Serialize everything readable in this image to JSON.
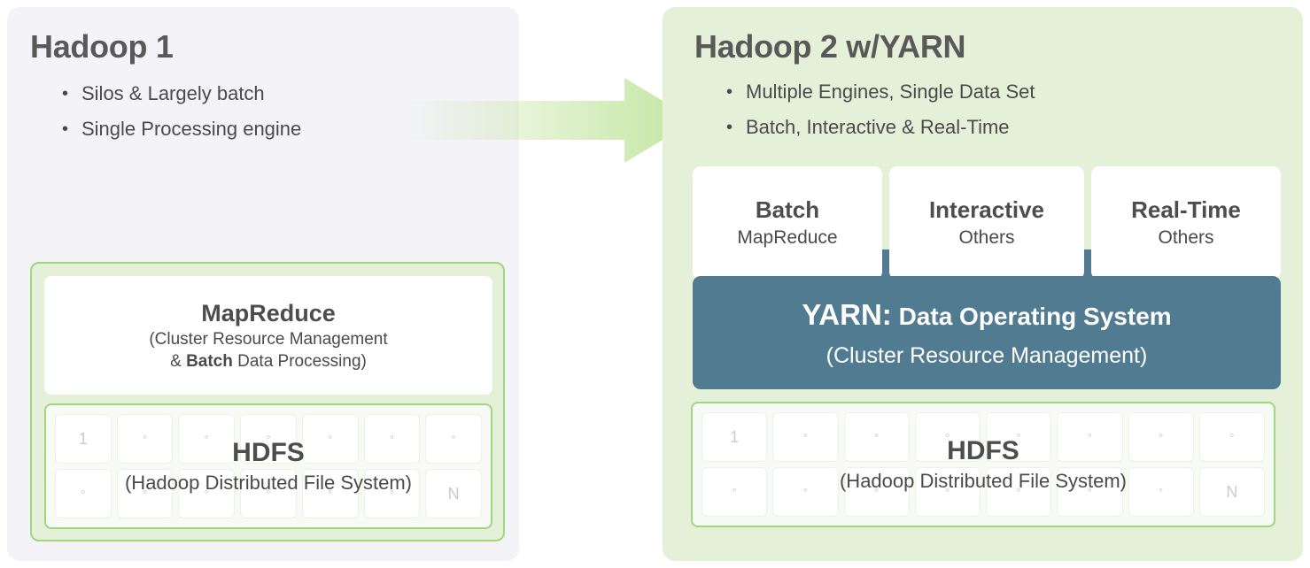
{
  "colors": {
    "left_panel_bg": "#f4f3f8",
    "right_panel_bg": "#e5f0d9",
    "green_border": "#a0d67e",
    "green_fill": "#e4f0d8",
    "yarn_bar": "#507b91",
    "heading_text": "#595959",
    "body_text": "#4a4a4a",
    "node_text": "#c9cdc7",
    "arrow_green": "#c3e5a0"
  },
  "left_panel": {
    "title": "Hadoop 1",
    "bullets": [
      "Silos & Largely batch",
      "Single Processing engine"
    ],
    "mapreduce": {
      "title": "MapReduce",
      "sub_line1": "(Cluster Resource Management",
      "sub_line2_prefix": "& ",
      "sub_line2_bold": "Batch",
      "sub_line2_suffix": " Data Processing)"
    },
    "hdfs": {
      "title": "HDFS",
      "subtitle": "(Hadoop Distributed File System)",
      "columns": 7,
      "rows": 2,
      "cells": [
        "1",
        "°",
        "°",
        "°",
        "°",
        "°",
        "°",
        "°",
        "°",
        "°",
        "°",
        "°",
        "°",
        "N"
      ]
    }
  },
  "arrow": {
    "label": "transition-arrow",
    "direction": "right"
  },
  "right_panel": {
    "title": "Hadoop 2 w/YARN",
    "bullets": [
      "Multiple Engines, Single Data Set",
      "Batch, Interactive & Real-Time"
    ],
    "engines": [
      {
        "title": "Batch",
        "sub": "MapReduce"
      },
      {
        "title": "Interactive",
        "sub": "Others"
      },
      {
        "title": "Real-Time",
        "sub": "Others"
      }
    ],
    "yarn": {
      "name": "YARN:",
      "tagline": " Data Operating System",
      "subtitle": "(Cluster Resource Management)"
    },
    "hdfs": {
      "title": "HDFS",
      "subtitle": "(Hadoop Distributed File System)",
      "columns": 8,
      "rows": 2,
      "cells": [
        "1",
        "°",
        "°",
        "°",
        "°",
        "°",
        "°",
        "°",
        "°",
        "°",
        "°",
        "°",
        "°",
        "°",
        "°",
        "N"
      ]
    }
  }
}
